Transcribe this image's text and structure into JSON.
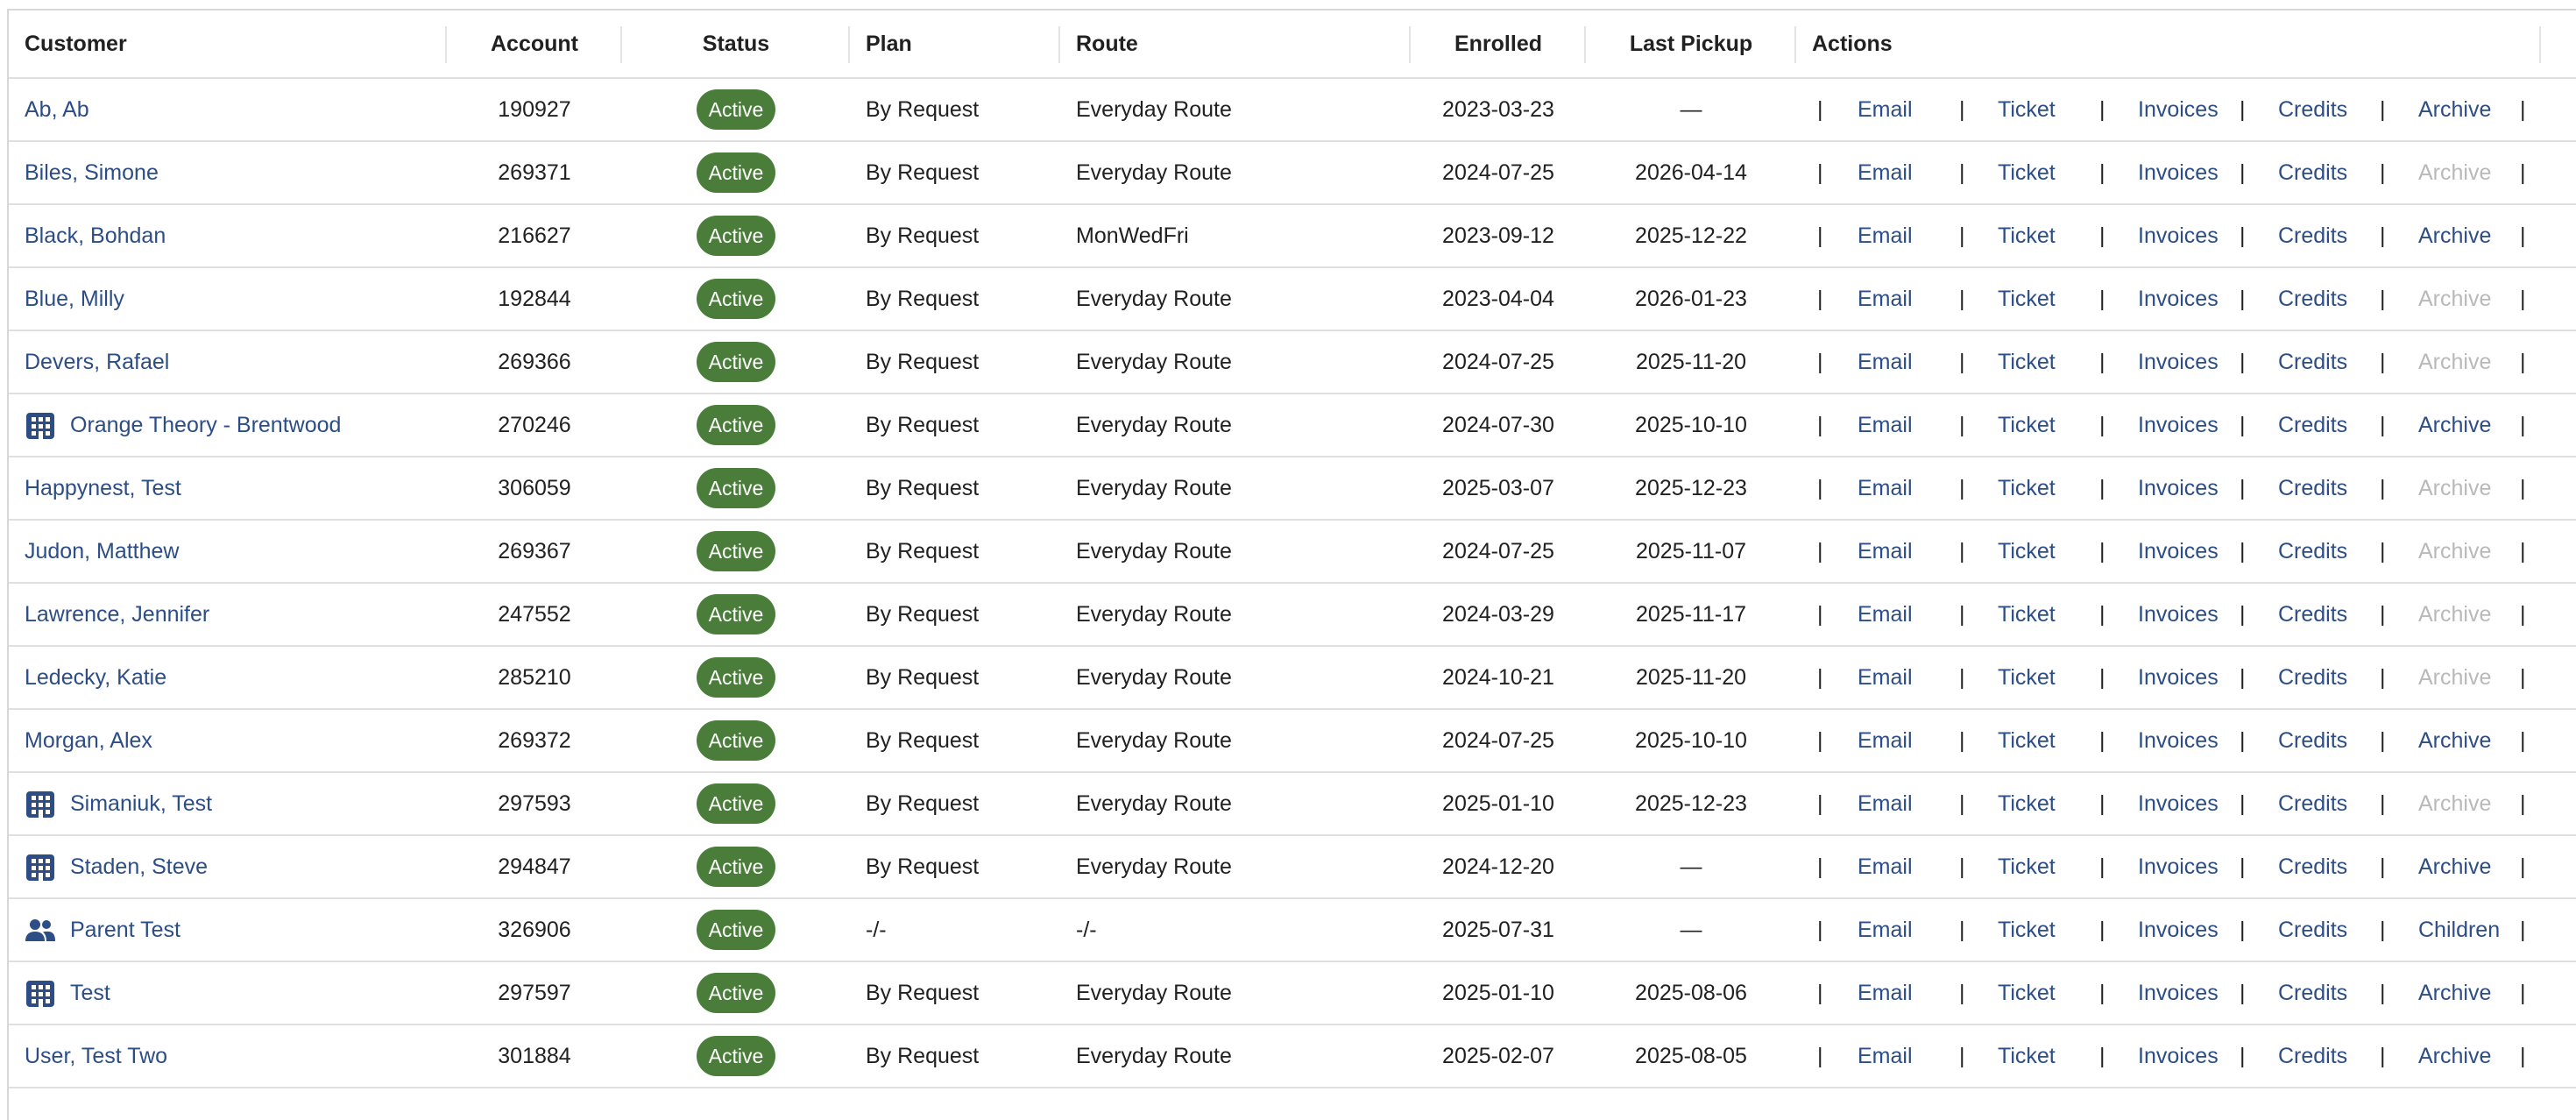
{
  "columns": {
    "customer": "Customer",
    "account": "Account",
    "status": "Status",
    "plan": "Plan",
    "route": "Route",
    "enrolled": "Enrolled",
    "last_pickup": "Last Pickup",
    "actions": "Actions"
  },
  "action_labels": {
    "email": "Email",
    "ticket": "Ticket",
    "invoices": "Invoices",
    "credits": "Credits",
    "archive": "Archive",
    "children": "Children",
    "pipe": "|"
  },
  "colors": {
    "link": "#2c4d86",
    "disabled": "#b9b9b9",
    "status_active": "#4a7d3a"
  },
  "rows": [
    {
      "customer": "Ab, Ab",
      "icon": "",
      "account": "190927",
      "status": "Active",
      "plan": "By Request",
      "route": "Everyday Route",
      "enrolled": "2023-03-23",
      "last_pickup": "—",
      "last_action": "archive",
      "last_enabled": true
    },
    {
      "customer": "Biles, Simone",
      "icon": "",
      "account": "269371",
      "status": "Active",
      "plan": "By Request",
      "route": "Everyday Route",
      "enrolled": "2024-07-25",
      "last_pickup": "2026-04-14",
      "last_action": "archive",
      "last_enabled": false
    },
    {
      "customer": "Black, Bohdan",
      "icon": "",
      "account": "216627",
      "status": "Active",
      "plan": "By Request",
      "route": "MonWedFri",
      "enrolled": "2023-09-12",
      "last_pickup": "2025-12-22",
      "last_action": "archive",
      "last_enabled": true
    },
    {
      "customer": "Blue, Milly",
      "icon": "",
      "account": "192844",
      "status": "Active",
      "plan": "By Request",
      "route": "Everyday Route",
      "enrolled": "2023-04-04",
      "last_pickup": "2026-01-23",
      "last_action": "archive",
      "last_enabled": false
    },
    {
      "customer": "Devers, Rafael",
      "icon": "",
      "account": "269366",
      "status": "Active",
      "plan": "By Request",
      "route": "Everyday Route",
      "enrolled": "2024-07-25",
      "last_pickup": "2025-11-20",
      "last_action": "archive",
      "last_enabled": false
    },
    {
      "customer": "Orange Theory - Brentwood",
      "icon": "building-icon",
      "account": "270246",
      "status": "Active",
      "plan": "By Request",
      "route": "Everyday Route",
      "enrolled": "2024-07-30",
      "last_pickup": "2025-10-10",
      "last_action": "archive",
      "last_enabled": true
    },
    {
      "customer": "Happynest, Test",
      "icon": "",
      "account": "306059",
      "status": "Active",
      "plan": "By Request",
      "route": "Everyday Route",
      "enrolled": "2025-03-07",
      "last_pickup": "2025-12-23",
      "last_action": "archive",
      "last_enabled": false
    },
    {
      "customer": "Judon, Matthew",
      "icon": "",
      "account": "269367",
      "status": "Active",
      "plan": "By Request",
      "route": "Everyday Route",
      "enrolled": "2024-07-25",
      "last_pickup": "2025-11-07",
      "last_action": "archive",
      "last_enabled": false
    },
    {
      "customer": "Lawrence, Jennifer",
      "icon": "",
      "account": "247552",
      "status": "Active",
      "plan": "By Request",
      "route": "Everyday Route",
      "enrolled": "2024-03-29",
      "last_pickup": "2025-11-17",
      "last_action": "archive",
      "last_enabled": false
    },
    {
      "customer": "Ledecky, Katie",
      "icon": "",
      "account": "285210",
      "status": "Active",
      "plan": "By Request",
      "route": "Everyday Route",
      "enrolled": "2024-10-21",
      "last_pickup": "2025-11-20",
      "last_action": "archive",
      "last_enabled": false
    },
    {
      "customer": "Morgan, Alex",
      "icon": "",
      "account": "269372",
      "status": "Active",
      "plan": "By Request",
      "route": "Everyday Route",
      "enrolled": "2024-07-25",
      "last_pickup": "2025-10-10",
      "last_action": "archive",
      "last_enabled": true
    },
    {
      "customer": "Simaniuk, Test",
      "icon": "building-icon",
      "account": "297593",
      "status": "Active",
      "plan": "By Request",
      "route": "Everyday Route",
      "enrolled": "2025-01-10",
      "last_pickup": "2025-12-23",
      "last_action": "archive",
      "last_enabled": false
    },
    {
      "customer": "Staden, Steve",
      "icon": "building-icon",
      "account": "294847",
      "status": "Active",
      "plan": "By Request",
      "route": "Everyday Route",
      "enrolled": "2024-12-20",
      "last_pickup": "—",
      "last_action": "archive",
      "last_enabled": true
    },
    {
      "customer": "Parent Test",
      "icon": "people-icon",
      "account": "326906",
      "status": "Active",
      "plan": "-/-",
      "route": "-/-",
      "enrolled": "2025-07-31",
      "last_pickup": "—",
      "last_action": "children",
      "last_enabled": true
    },
    {
      "customer": "Test",
      "icon": "building-icon",
      "account": "297597",
      "status": "Active",
      "plan": "By Request",
      "route": "Everyday Route",
      "enrolled": "2025-01-10",
      "last_pickup": "2025-08-06",
      "last_action": "archive",
      "last_enabled": true
    },
    {
      "customer": "User, Test Two",
      "icon": "",
      "account": "301884",
      "status": "Active",
      "plan": "By Request",
      "route": "Everyday Route",
      "enrolled": "2025-02-07",
      "last_pickup": "2025-08-05",
      "last_action": "archive",
      "last_enabled": true
    }
  ]
}
